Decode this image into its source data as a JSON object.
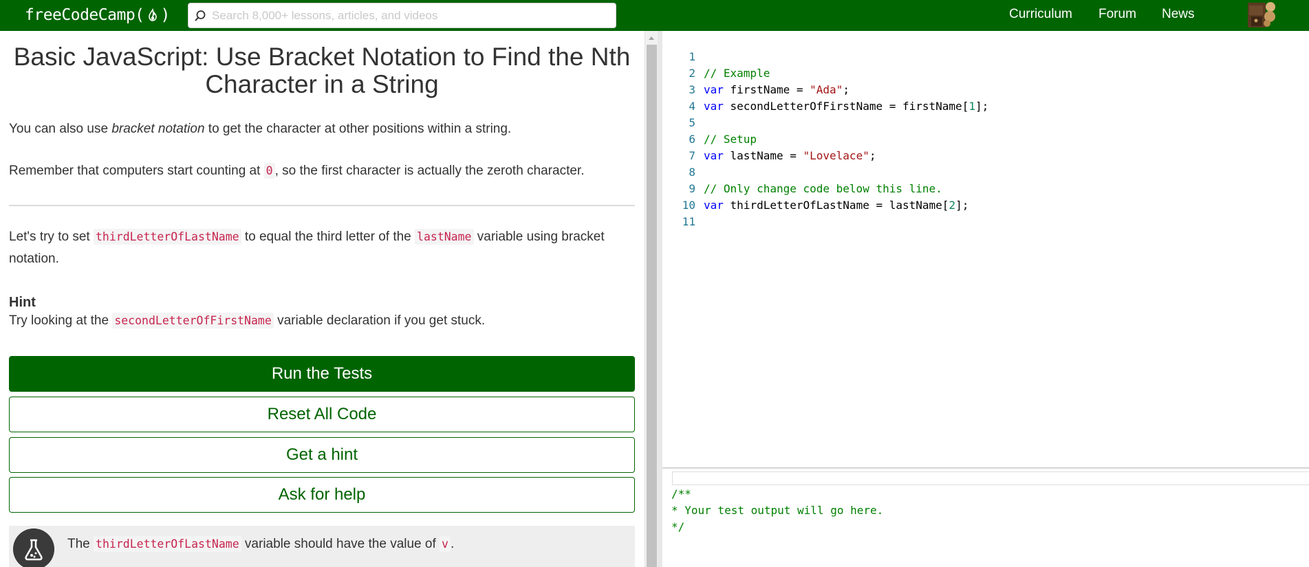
{
  "nav": {
    "logo_text_left": "freeCodeCamp(",
    "logo_text_right": ")",
    "search_placeholder": "Search 8,000+ lessons, articles, and videos",
    "links": [
      "Curriculum",
      "Forum",
      "News"
    ]
  },
  "colors": {
    "brand": "#006400",
    "code_inline": "#c7254e",
    "comment": "#008000",
    "keyword": "#0000ff",
    "string": "#a31515",
    "number": "#098658",
    "line_number": "#237893"
  },
  "challenge": {
    "title": "Basic JavaScript: Use Bracket Notation to Find the Nth Character in a String",
    "p1_before": "You can also use ",
    "p1_em": "bracket notation",
    "p1_after": " to get the character at other positions within a string.",
    "p2_before": "Remember that computers start counting at ",
    "p2_code": "0",
    "p2_after": ", so the first character is actually the zeroth character.",
    "p3_before": "Let's try to set ",
    "p3_code1": "thirdLetterOfLastName",
    "p3_mid": " to equal the third letter of the ",
    "p3_code2": "lastName",
    "p3_after": " variable using bracket notation.",
    "hint_title": "Hint",
    "hint_before": "Try looking at the ",
    "hint_code": "secondLetterOfFirstName",
    "hint_after": " variable declaration if you get stuck."
  },
  "buttons": {
    "run": "Run the Tests",
    "reset": "Reset All Code",
    "hint": "Get a hint",
    "help": "Ask for help"
  },
  "test": {
    "before": "The ",
    "code1": "thirdLetterOfLastName",
    "mid": " variable should have the value of ",
    "code2": "v",
    "after": "."
  },
  "editor": {
    "line_numbers": [
      "1",
      "2",
      "3",
      "4",
      "5",
      "6",
      "7",
      "8",
      "9",
      "10",
      "11"
    ],
    "l1": "// Example",
    "l2_kw": "var",
    "l2_a": " firstName = ",
    "l2_str": "\"Ada\"",
    "l2_b": ";",
    "l3_kw": "var",
    "l3_a": " secondLetterOfFirstName = firstName[",
    "l3_num": "1",
    "l3_b": "];",
    "l5": "// Setup",
    "l6_kw": "var",
    "l6_a": " lastName = ",
    "l6_str": "\"Lovelace\"",
    "l6_b": ";",
    "l8": "// Only change code below this line.",
    "l9_kw": "var",
    "l9_a": " thirdLetterOfLastName = lastName[",
    "l9_num": "2",
    "l9_b": "];"
  },
  "output": {
    "text": "/**\n* Your test output will go here.\n*/"
  }
}
